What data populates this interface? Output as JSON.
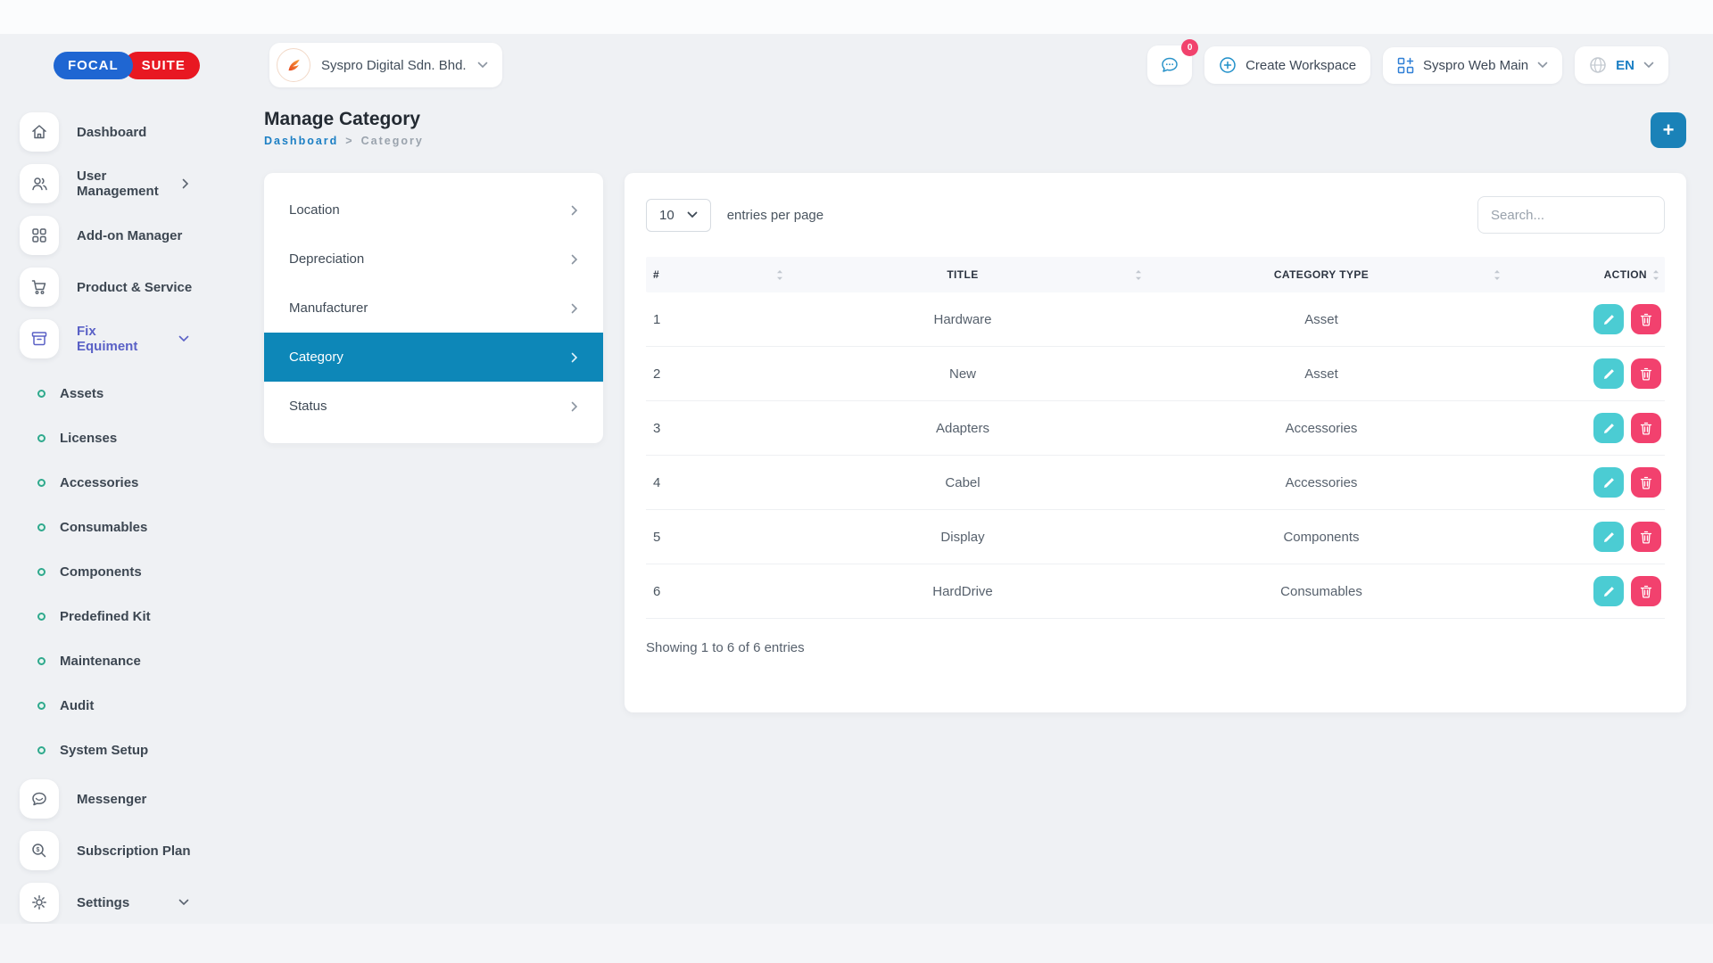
{
  "brand": {
    "logo_left": "FOCAL",
    "logo_right": "SUITE"
  },
  "topbar": {
    "company_name": "Syspro Digital Sdn. Bhd.",
    "chat_badge": "0",
    "create_workspace_label": "Create Workspace",
    "workspace_selector_label": "Syspro Web Main",
    "language_label": "EN"
  },
  "sidebar": {
    "items": [
      {
        "label": "Dashboard"
      },
      {
        "label": "User Management"
      },
      {
        "label": "Add-on Manager"
      },
      {
        "label": "Product & Service"
      },
      {
        "label": "Fix Equiment"
      }
    ],
    "sub_items": [
      "Assets",
      "Licenses",
      "Accessories",
      "Consumables",
      "Components",
      "Predefined Kit",
      "Maintenance",
      "Audit",
      "System Setup"
    ],
    "bottom_items": [
      {
        "label": "Messenger"
      },
      {
        "label": "Subscription Plan"
      },
      {
        "label": "Settings"
      }
    ]
  },
  "page": {
    "title": "Manage Category",
    "breadcrumb": {
      "parent": "Dashboard",
      "separator": ">",
      "current": "Category"
    },
    "add_button_label": "+"
  },
  "submenu": {
    "items": [
      {
        "label": "Location",
        "active": false
      },
      {
        "label": "Depreciation",
        "active": false
      },
      {
        "label": "Manufacturer",
        "active": false
      },
      {
        "label": "Category",
        "active": true
      },
      {
        "label": "Status",
        "active": false
      }
    ]
  },
  "table": {
    "entries_per_page": "10",
    "entries_label": "entries per page",
    "search_placeholder": "Search...",
    "columns": [
      "#",
      "TITLE",
      "CATEGORY TYPE",
      "ACTION"
    ],
    "rows": [
      {
        "num": "1",
        "title": "Hardware",
        "type": "Asset"
      },
      {
        "num": "2",
        "title": "New",
        "type": "Asset"
      },
      {
        "num": "3",
        "title": "Adapters",
        "type": "Accessories"
      },
      {
        "num": "4",
        "title": "Cabel",
        "type": "Accessories"
      },
      {
        "num": "5",
        "title": "Display",
        "type": "Components"
      },
      {
        "num": "6",
        "title": "HardDrive",
        "type": "Consumables"
      }
    ],
    "footer": "Showing 1 to 6 of 6 entries"
  },
  "colors": {
    "accent_blue": "#1b7fc4",
    "active_submenu_blue": "#0d87b8",
    "add_button_blue": "#1a82b8",
    "sidebar_active_purple": "#5a61c6",
    "edit_teal": "#4bccd3",
    "delete_pink": "#f2416e",
    "badge_red": "#f1426d",
    "logo_blue": "#1f66d2",
    "logo_red": "#e81822"
  }
}
